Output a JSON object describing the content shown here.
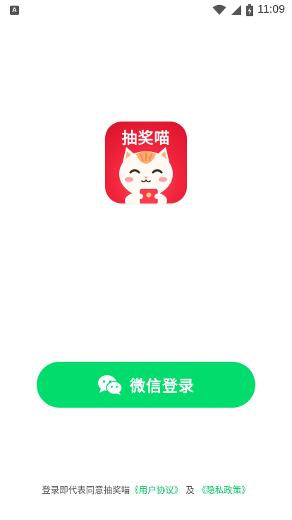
{
  "status_bar": {
    "notification_glyph": "A",
    "time": "11:09",
    "icons": [
      "wifi-icon",
      "signal-icon",
      "battery-charging-icon"
    ]
  },
  "app_icon": {
    "title": "抽奖喵",
    "colors": {
      "background": "#f2263d",
      "envelope": "#ff3b4f"
    }
  },
  "login": {
    "wechat_label": "微信登录",
    "button_color": "#02dc6c"
  },
  "agreement": {
    "prefix": "登录即代表同意抽奖喵",
    "user_agreement": "《用户协议》",
    "connector": "及",
    "privacy_policy": "《隐私政策》",
    "link_color": "#07c160"
  }
}
